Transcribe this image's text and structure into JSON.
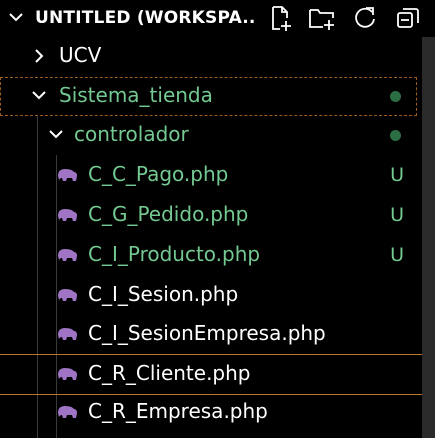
{
  "explorer": {
    "title": "UNTITLED (WORKSPA...",
    "actions": [
      "new-file-icon",
      "new-folder-icon",
      "refresh-icon",
      "collapse-all-icon"
    ]
  },
  "tree": {
    "folders": {
      "ucv": "UCV",
      "sistema": "Sistema_tienda",
      "controlador": "controlador"
    },
    "files": [
      {
        "name": "C_C_Pago.php",
        "status": "U"
      },
      {
        "name": "C_G_Pedido.php",
        "status": "U"
      },
      {
        "name": "C_I_Producto.php",
        "status": "U"
      },
      {
        "name": "C_I_Sesion.php",
        "status": ""
      },
      {
        "name": "C_I_SesionEmpresa.php",
        "status": ""
      },
      {
        "name": "C_R_Cliente.php",
        "status": ""
      },
      {
        "name": "C_R_Empresa.php",
        "status": ""
      }
    ]
  },
  "colors": {
    "untracked": "#73c991",
    "php_icon": "#a074c4",
    "focus_border": "#b9752a"
  }
}
